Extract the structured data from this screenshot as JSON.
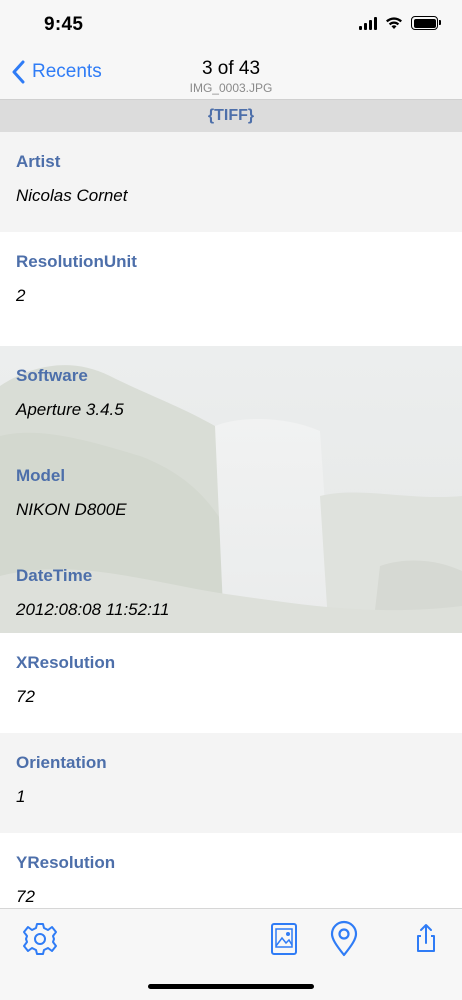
{
  "status_bar": {
    "time": "9:45"
  },
  "nav": {
    "back_label": "Recents",
    "title": "3 of 43",
    "subtitle": "IMG_0003.JPG"
  },
  "section": {
    "title": "{TIFF}"
  },
  "rows": [
    {
      "label": "Artist",
      "value": "Nicolas Cornet"
    },
    {
      "label": "ResolutionUnit",
      "value": "2"
    },
    {
      "label": "Software",
      "value": "Aperture 3.4.5"
    },
    {
      "label": "Model",
      "value": "NIKON D800E"
    },
    {
      "label": "DateTime",
      "value": "2012:08:08 11:52:11"
    },
    {
      "label": "XResolution",
      "value": "72"
    },
    {
      "label": "Orientation",
      "value": "1"
    },
    {
      "label": "YResolution",
      "value": "72"
    }
  ],
  "toolbar": {
    "settings_icon": "gear-icon",
    "photo_icon": "photo-icon",
    "location_icon": "map-pin-icon",
    "share_icon": "share-icon"
  },
  "colors": {
    "accent": "#2f7cf6",
    "label": "#4d6faa",
    "header_bg": "#dcdcdc",
    "alt_row_bg": "#f4f4f4"
  }
}
